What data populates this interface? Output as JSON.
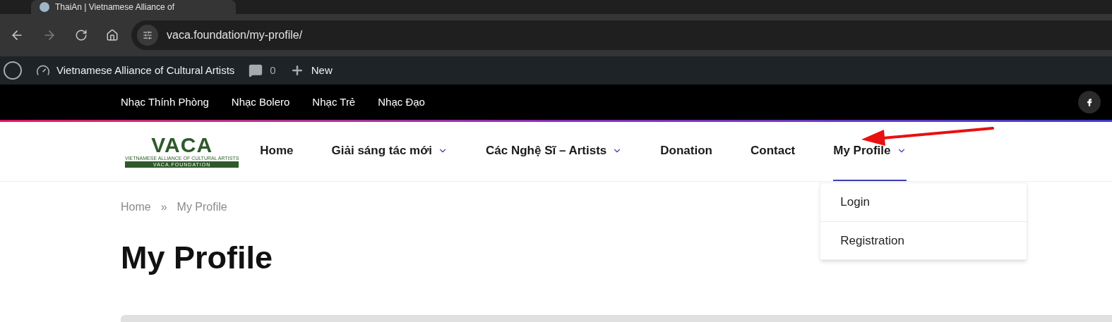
{
  "browser": {
    "tab_title": "ThaiAn | Vietnamese Alliance of",
    "url": "vaca.foundation/my-profile/"
  },
  "admin_bar": {
    "site_name": "Vietnamese Alliance of Cultural Artists",
    "comments": "0",
    "new_label": "New"
  },
  "top_bar": {
    "links": [
      "Nhạc Thính Phòng",
      "Nhạc Bolero",
      "Nhạc Trẻ",
      "Nhạc Đạo"
    ]
  },
  "logo": {
    "mark": "VACA",
    "tagline": "VIETNAMESE ALLIANCE OF CULTURAL ARTISTS",
    "domain": "VACA.FOUNDATION"
  },
  "nav": [
    {
      "label": "Home",
      "has_submenu": false,
      "selected": false
    },
    {
      "label": "Giải sáng tác mới",
      "has_submenu": true,
      "selected": false
    },
    {
      "label": "Các Nghệ Sĩ – Artists",
      "has_submenu": true,
      "selected": false
    },
    {
      "label": "Donation",
      "has_submenu": false,
      "selected": false
    },
    {
      "label": "Contact",
      "has_submenu": false,
      "selected": false
    },
    {
      "label": "My Profile",
      "has_submenu": true,
      "selected": true,
      "expanded": true,
      "submenu": [
        "Login",
        "Registration"
      ]
    }
  ],
  "breadcrumb": {
    "items": [
      "Home",
      "My Profile"
    ],
    "separator": "»"
  },
  "page_title": "My Profile"
}
